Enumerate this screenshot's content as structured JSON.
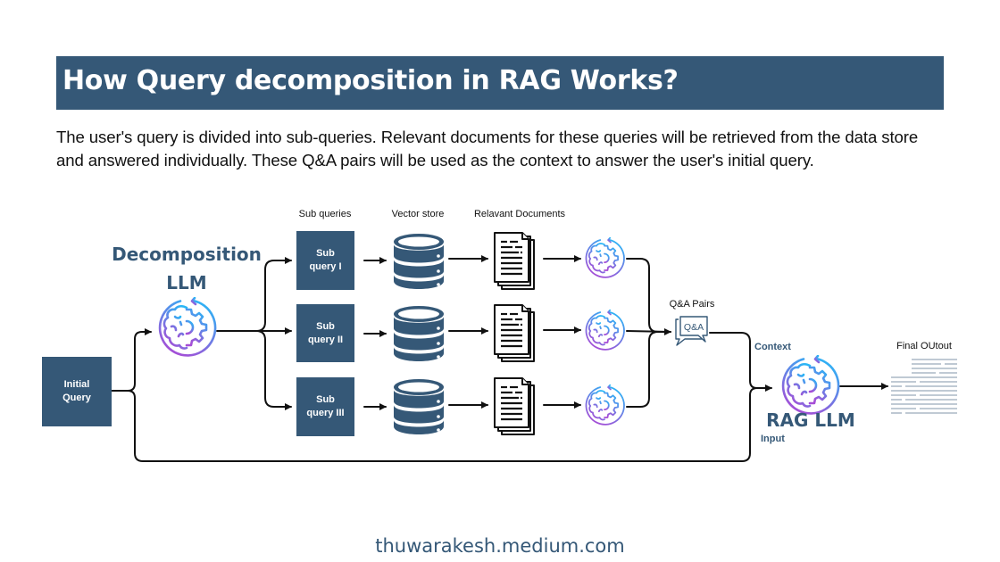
{
  "title": "How Query decomposition in RAG Works?",
  "description": "The user's query is divided into sub-queries. Relevant documents for these queries will be retrieved from the data store and answered individually. These Q&A pairs will be used as the context to answer the user's initial query.",
  "columns": {
    "sub_queries": "Sub queries",
    "vector_store": "Vector store",
    "documents": "Relavant Documents"
  },
  "initial_query": {
    "line1": "Initial",
    "line2": "Query"
  },
  "decomposition_llm": {
    "line1": "Decomposition",
    "line2": "LLM",
    "icon": "brain-gear-icon"
  },
  "sub_queries": [
    {
      "line1": "Sub",
      "line2": "query I"
    },
    {
      "line1": "Sub",
      "line2": "query II"
    },
    {
      "line1": "Sub",
      "line2": "query III"
    }
  ],
  "icons": {
    "vector_store": "database-icon",
    "documents": "documents-icon",
    "llm": "brain-gear-icon",
    "qa": "chat-bubbles-icon",
    "output": "text-lines-icon"
  },
  "qa_pairs": {
    "label": "Q&A Pairs",
    "icon_text": "Q&A"
  },
  "rag_llm": {
    "label": "RAG LLM",
    "context_label": "Context",
    "input_label": "Input"
  },
  "final_output": {
    "label": "Final OUtout"
  },
  "footer": "thuwarakesh.medium.com",
  "colors": {
    "primary": "#355877",
    "gradient_start": "#29b6f6",
    "gradient_end": "#a64dd6",
    "output_lines": "#9aaabb"
  }
}
